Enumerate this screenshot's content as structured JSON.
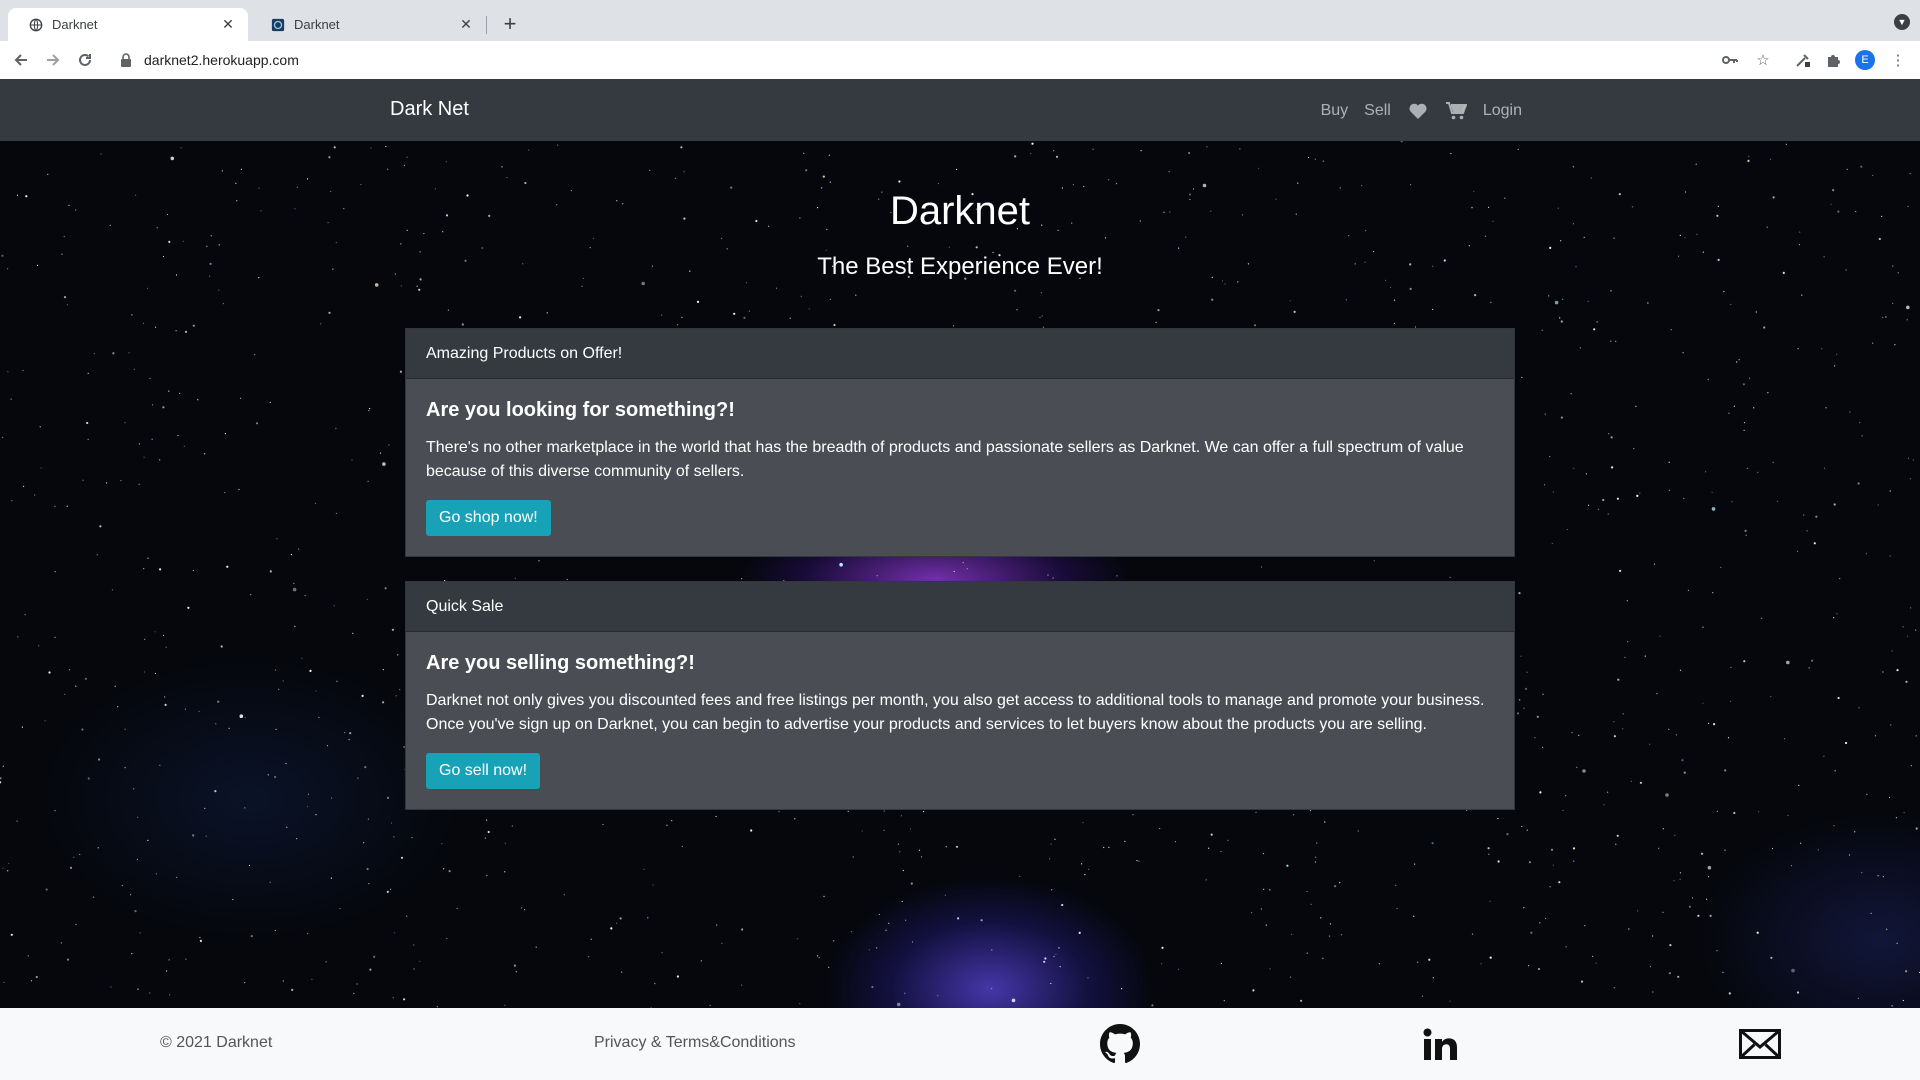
{
  "browser": {
    "tabs": [
      {
        "title": "Darknet",
        "favicon": "globe-icon",
        "active": true
      },
      {
        "title": "Darknet",
        "favicon": "site-favicon-icon",
        "active": false
      }
    ],
    "url": "darknet2.herokuapp.com",
    "profile_initial": "E"
  },
  "navbar": {
    "brand": "Dark Net",
    "links": {
      "buy": "Buy",
      "sell": "Sell",
      "login": "Login"
    },
    "icons": [
      "heart-icon",
      "cart-icon"
    ]
  },
  "hero": {
    "title": "Darknet",
    "subtitle": "The Best Experience Ever!"
  },
  "cards": [
    {
      "header": "Amazing Products on Offer!",
      "title": "Are you looking for something?!",
      "text": "There's no other marketplace in the world that has the breadth of products and passionate sellers as Darknet. We can offer a full spectrum of value because of this diverse community of sellers.",
      "button": "Go shop now!"
    },
    {
      "header": "Quick Sale",
      "title": "Are you selling something?!",
      "text": "Darknet not only gives you discounted fees and free listings per month, you also get access to additional tools to manage and promote your business. Once you've sign up on Darknet, you can begin to advertise your products and services to let buyers know about the products you are selling.",
      "button": "Go sell now!"
    }
  ],
  "footer": {
    "copyright": "© 2021 Darknet",
    "privacy": "Privacy & Terms&Conditions",
    "icons": [
      "github-icon",
      "linkedin-icon",
      "mail-icon"
    ]
  },
  "colors": {
    "navbar_bg": "#343a40",
    "card_bg": "#4a4e54",
    "button": "#17a2b8",
    "footer_bg": "#f8f9fa"
  }
}
